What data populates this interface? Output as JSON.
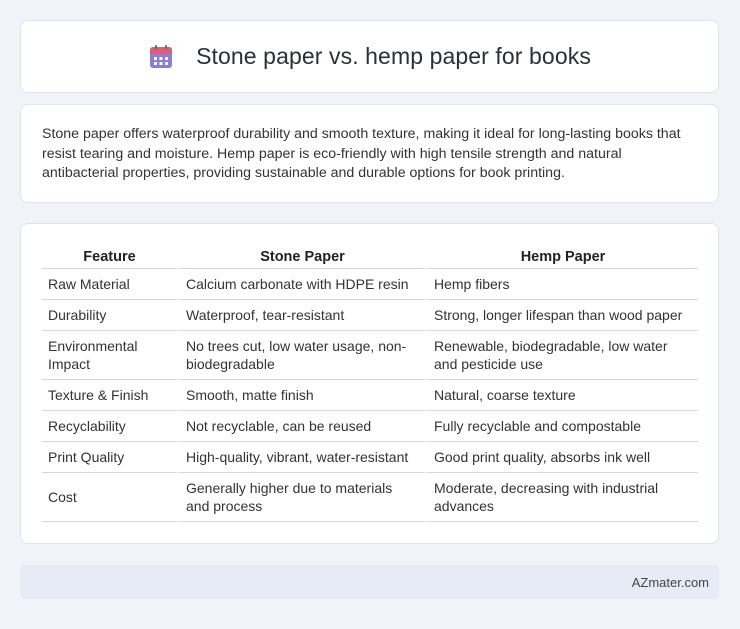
{
  "header": {
    "title": "Stone paper vs. hemp paper for books",
    "icon": "calendar-icon",
    "icon_colors": {
      "top": "#e25a7c",
      "body": "#8a7fd8",
      "dots": "#ffffff"
    }
  },
  "intro": {
    "text": "Stone paper offers waterproof durability and smooth texture, making it ideal for long-lasting books that resist tearing and moisture. Hemp paper is eco-friendly with high tensile strength and natural antibacterial properties, providing sustainable and durable options for book printing."
  },
  "table": {
    "headers": [
      "Feature",
      "Stone Paper",
      "Hemp Paper"
    ],
    "rows": [
      [
        "Raw Material",
        "Calcium carbonate with HDPE resin",
        "Hemp fibers"
      ],
      [
        "Durability",
        "Waterproof, tear-resistant",
        "Strong, longer lifespan than wood paper"
      ],
      [
        "Environmental Impact",
        "No trees cut, low water usage, non-biodegradable",
        "Renewable, biodegradable, low water and pesticide use"
      ],
      [
        "Texture & Finish",
        "Smooth, matte finish",
        "Natural, coarse texture"
      ],
      [
        "Recyclability",
        "Not recyclable, can be reused",
        "Fully recyclable and compostable"
      ],
      [
        "Print Quality",
        "High-quality, vibrant, water-resistant",
        "Good print quality, absorbs ink well"
      ],
      [
        "Cost",
        "Generally higher due to materials and process",
        "Moderate, decreasing with industrial advances"
      ]
    ]
  },
  "footer": {
    "brand": "AZmater.com"
  }
}
